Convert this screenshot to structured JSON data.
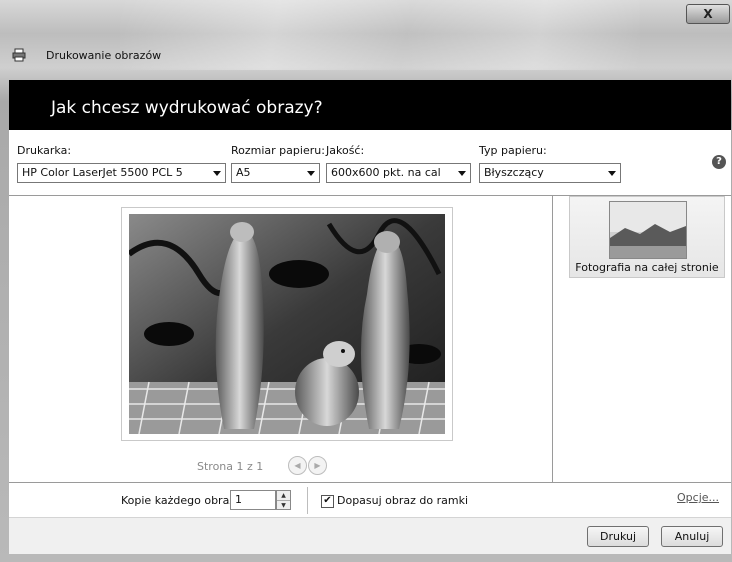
{
  "window": {
    "title": "Drukowanie obrazów",
    "close_label": "X"
  },
  "header": {
    "heading": "Jak chcesz wydrukować obrazy?"
  },
  "options": {
    "printer_label": "Drukarka:",
    "printer_value": "HP Color LaserJet 5500 PCL 5",
    "paper_size_label": "Rozmiar papieru:",
    "paper_size_value": "A5",
    "quality_label": "Jakość:",
    "quality_value": "600x600 pkt. na cal",
    "paper_type_label": "Typ papieru:",
    "paper_type_value": "Błyszczący",
    "help_icon": "question-mark-icon",
    "help_glyph": "?"
  },
  "preview": {
    "page_indicator": "Strona 1 z 1",
    "prev_icon": "arrow-left-icon",
    "next_icon": "arrow-right-icon",
    "prev_glyph": "◀",
    "next_glyph": "▶"
  },
  "layouts": {
    "items": [
      {
        "label": "Fotografia na całej stronie"
      }
    ]
  },
  "copies": {
    "label": "Kopie każdego obrazu:",
    "value": "1",
    "up_glyph": "▲",
    "down_glyph": "▼",
    "fit_label": "Dopasuj obraz do ramki",
    "fit_checked": true,
    "check_glyph": "✔",
    "options_link": "Opcje..."
  },
  "buttons": {
    "print": "Drukuj",
    "cancel": "Anuluj"
  }
}
